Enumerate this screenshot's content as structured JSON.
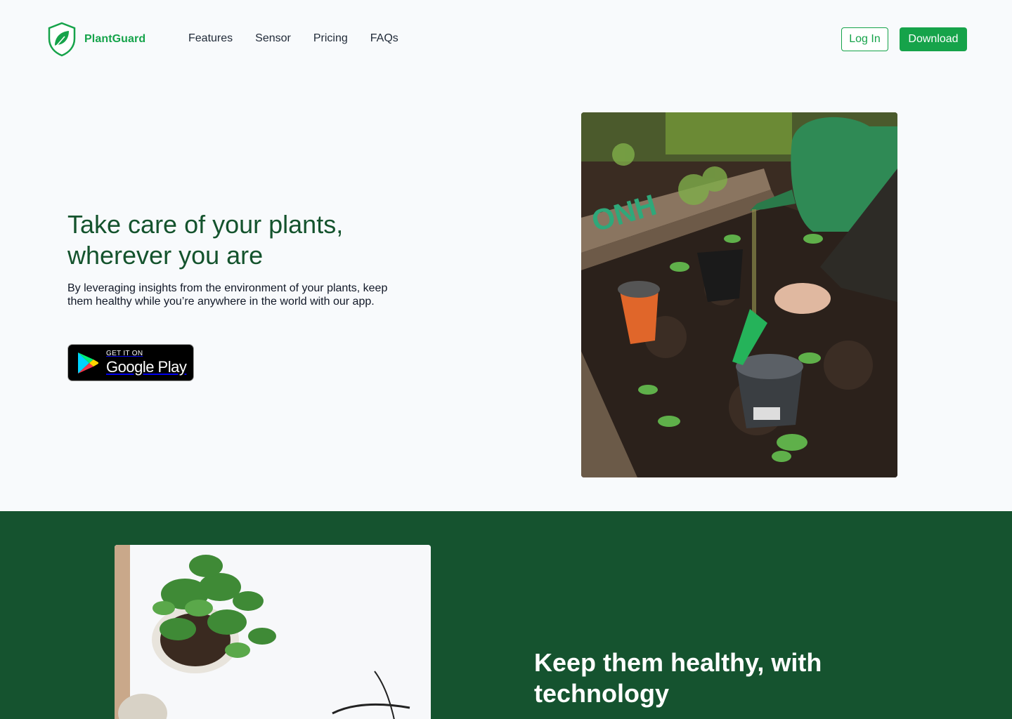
{
  "brand": {
    "name": "PlantGuard",
    "accent": "#16a34a",
    "dark_green": "#14532d"
  },
  "nav": {
    "items": [
      "Features",
      "Sensor",
      "Pricing",
      "FAQs"
    ]
  },
  "actions": {
    "login": "Log In",
    "download": "Download"
  },
  "hero": {
    "title": "Take care of your plants, wherever you are",
    "subtitle": "By leveraging insights from the environment of your plants, keep them healthy while you’re anywhere in the world with our app.",
    "badge_small": "GET IT ON",
    "badge_big": "Google Play"
  },
  "section2": {
    "title": "Keep them healthy, with technology"
  }
}
